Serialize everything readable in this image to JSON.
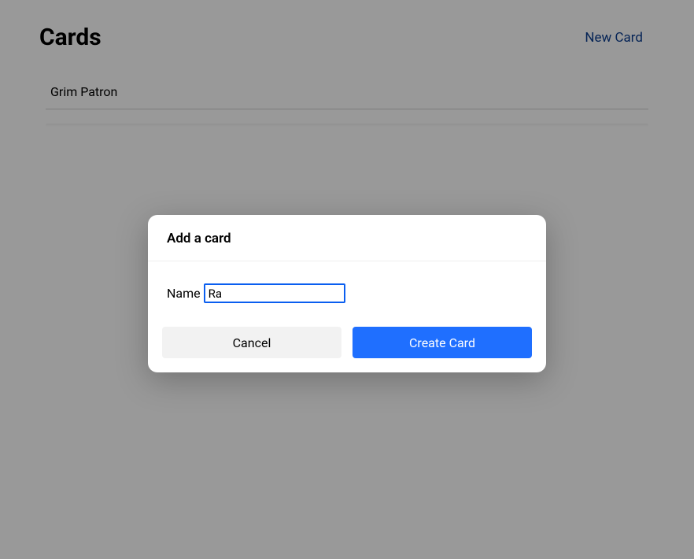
{
  "header": {
    "title": "Cards",
    "new_card_label": "New Card"
  },
  "cards": [
    {
      "name": "Grim Patron"
    }
  ],
  "modal": {
    "title": "Add a card",
    "name_label": "Name",
    "name_value": "Ra",
    "cancel_label": "Cancel",
    "create_label": "Create Card"
  }
}
